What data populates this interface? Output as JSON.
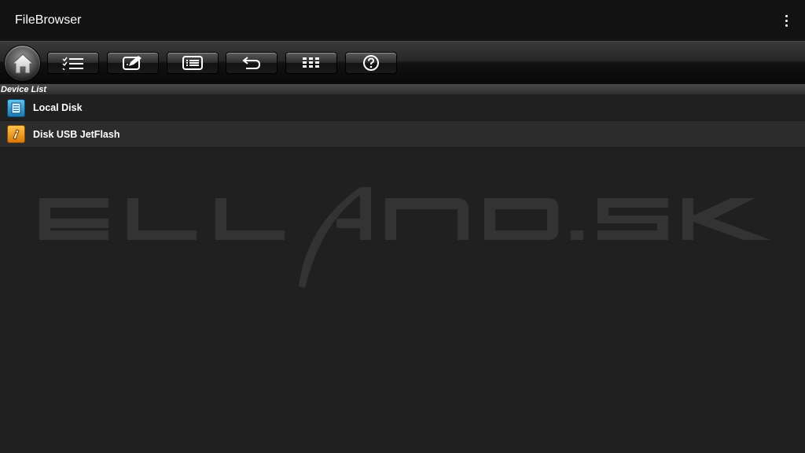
{
  "app": {
    "title": "FileBrowser"
  },
  "toolbar": {
    "buttons": [
      {
        "name": "home-button",
        "icon": "home-icon"
      },
      {
        "name": "multi-select-button",
        "icon": "checklist-icon"
      },
      {
        "name": "edit-button",
        "icon": "edit-icon"
      },
      {
        "name": "list-view-button",
        "icon": "list-icon"
      },
      {
        "name": "back-button",
        "icon": "undo-arrow-icon"
      },
      {
        "name": "grid-view-button",
        "icon": "grid-icon"
      },
      {
        "name": "help-button",
        "icon": "question-icon"
      }
    ]
  },
  "section": {
    "header": "Device List"
  },
  "devices": [
    {
      "label": "Local Disk",
      "icon": "local-disk-icon",
      "color": "#2a8fcc"
    },
    {
      "label": "Disk USB JetFlash",
      "icon": "usb-disk-icon",
      "color": "#f0a020"
    }
  ],
  "watermark": {
    "text": "ELLANO.SK"
  }
}
